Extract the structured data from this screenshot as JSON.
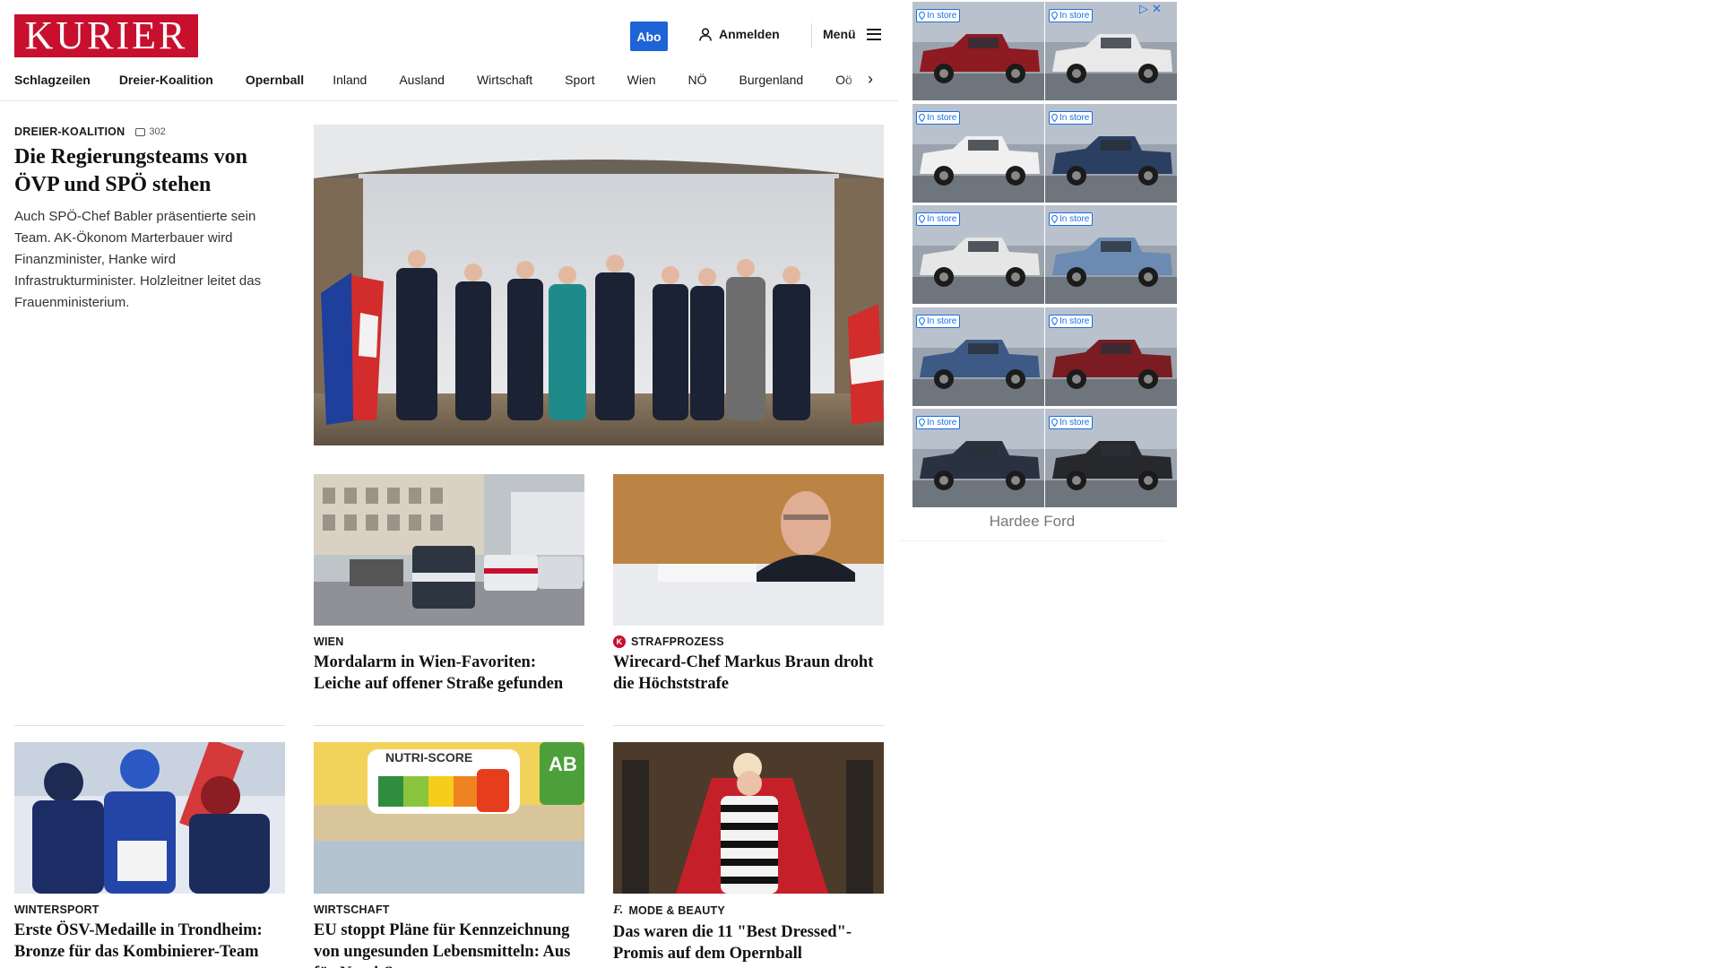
{
  "header": {
    "logo": "KURIER",
    "abo_label": "Abo",
    "login_label": "Anmelden",
    "menu_label": "Menü"
  },
  "nav": {
    "items": [
      {
        "label": "Schlagzeilen",
        "bold": true
      },
      {
        "label": "Dreier-Koalition",
        "bold": true
      },
      {
        "label": "Opernball",
        "bold": true
      },
      {
        "label": "Inland",
        "bold": false
      },
      {
        "label": "Ausland",
        "bold": false
      },
      {
        "label": "Wirtschaft",
        "bold": false
      },
      {
        "label": "Sport",
        "bold": false
      },
      {
        "label": "Wien",
        "bold": false
      },
      {
        "label": "NÖ",
        "bold": false
      },
      {
        "label": "Burgenland",
        "bold": false
      },
      {
        "label": "Oö",
        "bold": false
      }
    ],
    "arrow": "›"
  },
  "lead": {
    "kicker": "DREIER-KOALITION",
    "comments": "302",
    "title": "Die Regierungsteams von ÖVP und SPÖ stehen",
    "teaser": "Auch SPÖ-Chef Babler präsentierte sein Team. AK-Ökonom Marterbauer wird Finanzminister, Hanke wird Infrastrukturminister. Holzleitner leitet das Frauenministerium."
  },
  "teasers": [
    {
      "kicker": "WIEN",
      "title": "Mordalarm in Wien-Favoriten: Leiche auf offener Straße gefunden",
      "image": "police-cars-street"
    },
    {
      "kicker": "STRAFPROZESS",
      "badge": "K",
      "title": "Wirecard-Chef Markus Braun droht die Höchststrafe",
      "image": "man-in-court"
    },
    {
      "kicker": "WINTERSPORT",
      "title": "Erste ÖSV-Medaille in Trondheim: Bronze für das Kombinierer-Team",
      "image": "athletes-celebrating"
    },
    {
      "kicker": "WIRTSCHAFT",
      "title": "EU stoppt Pläne für Kennzeichnung von ungesunden Lebensmitteln: Aus für Nutri-Score",
      "image": "nutri-score-label",
      "nutri": "NUTRI-SCORE",
      "bio": "AB"
    },
    {
      "kicker": "MODE & BEAUTY",
      "badge": "f.",
      "title": "Das waren die 11 \"Best Dressed\"-Promis auf dem Opernball",
      "image": "woman-red-carpet"
    }
  ],
  "ad": {
    "instore_label": "In store",
    "advertiser": "Hardee Ford",
    "tiles": [
      {
        "color": "#8e1a22"
      },
      {
        "color": "#e9e9e9"
      },
      {
        "color": "#f0f0f0"
      },
      {
        "color": "#2b3f62"
      },
      {
        "color": "#e6e6e6"
      },
      {
        "color": "#6c8bb3"
      },
      {
        "color": "#3d5a86"
      },
      {
        "color": "#7a1c22"
      },
      {
        "color": "#2a3242"
      },
      {
        "color": "#26282c"
      }
    ]
  }
}
